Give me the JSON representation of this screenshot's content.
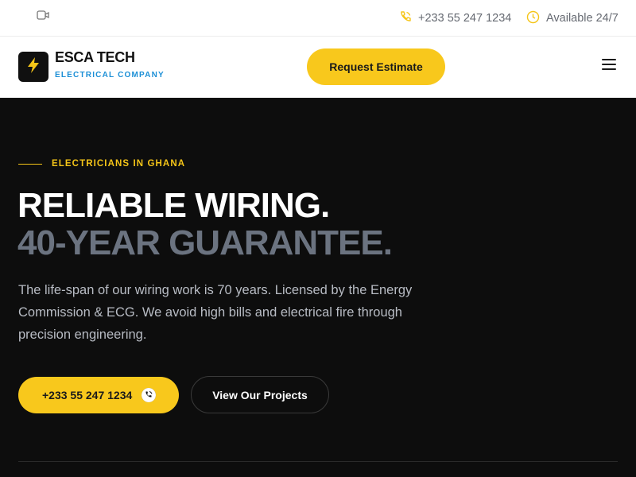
{
  "topbar": {
    "video_icon": "video-camera-icon",
    "phone_icon": "phone-icon",
    "phone": "+233 55 247 1234",
    "clock_icon": "clock-icon",
    "availability": "Available 24/7"
  },
  "header": {
    "logo_icon": "lightning-bolt-icon",
    "brand_name": "ESCA TECH",
    "brand_tagline": "ELECTRICAL COMPANY",
    "estimate_label": "Request Estimate",
    "menu_icon": "hamburger-menu-icon"
  },
  "hero": {
    "eyebrow": "ELECTRICIANS IN GHANA",
    "headline_line1": "RELIABLE WIRING.",
    "headline_line2": "40-YEAR GUARANTEE.",
    "description": "The life-span of our wiring work is 70 years. Licensed by the Energy Commission & ECG. We avoid high bills and electrical fire through precision engineering.",
    "call_label": "+233 55 247 1234",
    "call_icon": "phone-call-icon",
    "projects_label": "View Our Projects"
  },
  "colors": {
    "accent": "#f8c81c",
    "dark": "#0d0d0d",
    "muted_headline": "#6b7380",
    "tagline_blue": "#1c8fd6"
  }
}
